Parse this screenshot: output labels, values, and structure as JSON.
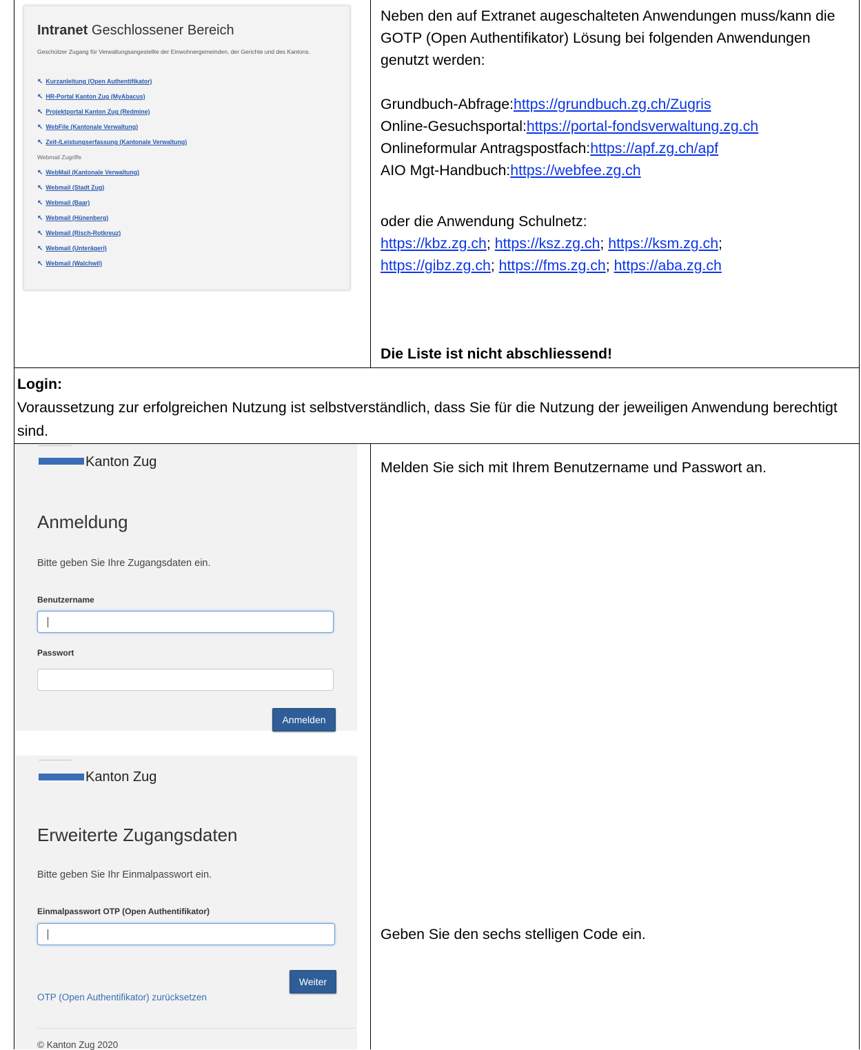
{
  "intranet": {
    "title_bold": "Intranet",
    "title_rest": "Geschlossener Bereich",
    "subtitle": "Geschützer Zugang für Verwaltungsangestellte der Einwohnergemeinden, der Gerichte und des Kantons.",
    "links": [
      "Kurzanleitung (Open Authentifikator)",
      "HR-Portal Kanton Zug (MyAbacus)",
      "Projektportal Kanton Zug (Redmine)",
      "WebFile (Kantonale Verwaltung)",
      "Zeit-/Leistungserfassung (Kantonale Verwaltung)"
    ],
    "section_label": "Webmail Zugriffe",
    "webmail_links": [
      "WebMail (Kantonale Verwaltung)",
      "Webmail (Stadt Zug)",
      "Webmail (Baar)",
      "Webmail (Hünenberg)",
      "Webmail (Risch-Rotkreuz)",
      "Webmail (Unterägeri)",
      "Webmail (Walchwil)"
    ],
    "arrow_glyph": "↖"
  },
  "apps": {
    "intro": "Neben den auf Extranet augeschalteten Anwendungen muss/kann die GOTP (Open Authentifikator) Lösung bei folgenden Anwendungen genutzt werden:",
    "entries": [
      {
        "label": "Grundbuch-Abfrage:",
        "url": "https://grundbuch.zg.ch/Zugris"
      },
      {
        "label": "Online-Gesuchsportal:",
        "url": "https://portal-fondsverwaltung.zg.ch"
      },
      {
        "label": "Onlineformular Antragspostfach:",
        "url": "https://apf.zg.ch/apf"
      },
      {
        "label": "AIO Mgt-Handbuch:",
        "url": "https://webfee.zg.ch"
      }
    ],
    "schulnetz_label": "oder die Anwendung Schulnetz:",
    "schulnetz_links": [
      "https://kbz.zg.ch",
      "https://ksz.zg.ch",
      "https://ksm.zg.ch",
      "https://gibz.zg.ch",
      "https://fms.zg.ch",
      "https://aba.zg.ch"
    ],
    "separator": ";",
    "note": "Die Liste ist nicht abschliessend!"
  },
  "login_section": {
    "heading": "Login:",
    "text": "Voraussetzung zur erfolgreichen Nutzung ist selbstverständlich, dass Sie für die Nutzung der jeweiligen Anwendung berechtigt sind."
  },
  "login_panel": {
    "brand": "Kanton Zug",
    "title": "Anmeldung",
    "description": "Bitte geben Sie Ihre Zugangsdaten ein.",
    "username_label": "Benutzername",
    "username_value": "",
    "password_label": "Passwort",
    "password_value": "",
    "submit": "Anmelden"
  },
  "otp_panel": {
    "brand": "Kanton Zug",
    "title": "Erweiterte Zugangsdaten",
    "description": "Bitte geben Sie Ihr Einmalpasswort ein.",
    "otp_label": "Einmalpasswort OTP (Open Authentifikator)",
    "otp_value": "",
    "submit": "Weiter",
    "reset_link": "OTP (Open Authentifikator) zurücksetzen",
    "footer": "© Kanton Zug 2020"
  },
  "instructions": {
    "login": "Melden Sie sich mit Ihrem Benutzername und Passwort an.",
    "otp": "Geben Sie den sechs stelligen Code ein."
  },
  "colors": {
    "link": "#0b35e6",
    "brand_blue": "#3a6db5",
    "button_blue": "#2e5d97"
  }
}
